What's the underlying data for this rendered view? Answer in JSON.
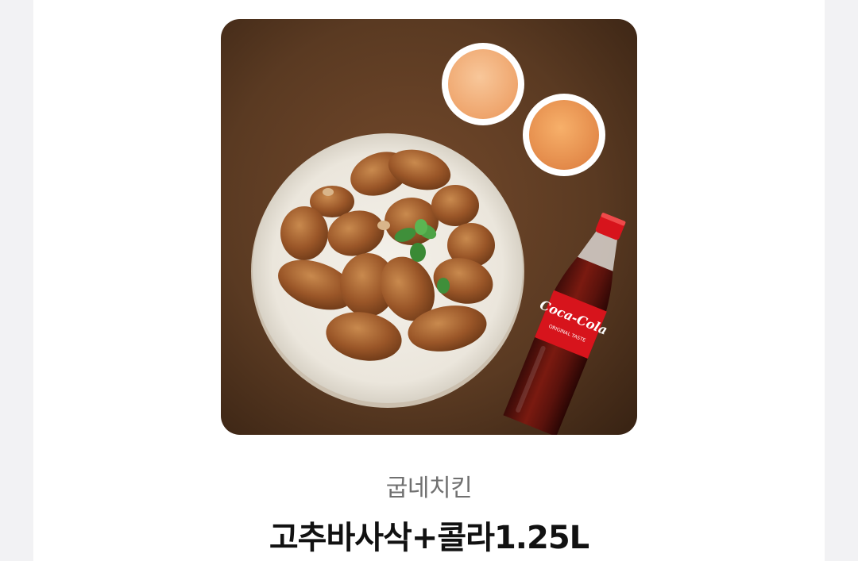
{
  "product": {
    "brand": "굽네치킨",
    "name": "고추바사삭+콜라1.25L",
    "image": {
      "bottle_label": "Coca-Cola",
      "bottle_sublabel": "ORIGINAL TASTE"
    }
  },
  "colors": {
    "page_background": "#f2f2f4",
    "card_background": "#ffffff",
    "brand_text": "#707070",
    "title_text": "#111111",
    "photo_background": "#5a3a22",
    "chicken": "#a55a2a",
    "sauce": "#f2a86a",
    "cola_red": "#d7141c"
  }
}
